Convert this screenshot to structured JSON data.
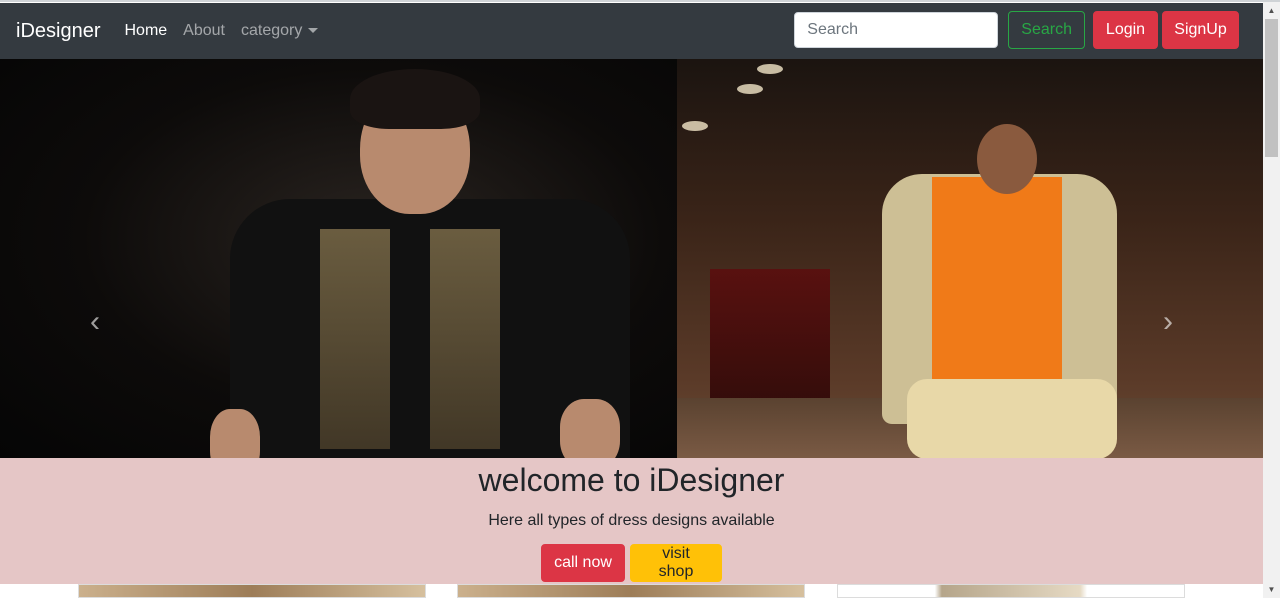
{
  "navbar": {
    "brand": "iDesigner",
    "links": [
      {
        "label": "Home",
        "active": true
      },
      {
        "label": "About",
        "active": false
      },
      {
        "label": "category",
        "active": false,
        "dropdown": true
      }
    ],
    "search": {
      "placeholder": "Search",
      "value": ""
    },
    "search_button": "Search",
    "login_button": "Login",
    "signup_button": "SignUp"
  },
  "carousel": {
    "prev_icon": "chevron-left-icon",
    "next_icon": "chevron-right-icon"
  },
  "hero": {
    "title": "welcome to iDesigner",
    "subtitle": "Here all types of dress designs available",
    "call_button": "call now",
    "shop_button": "visit shop"
  },
  "colors": {
    "navbar_bg": "#343a40",
    "hero_bg": "#e5c6c6",
    "danger": "#dc3545",
    "success": "#28a745",
    "warning": "#ffc107"
  }
}
